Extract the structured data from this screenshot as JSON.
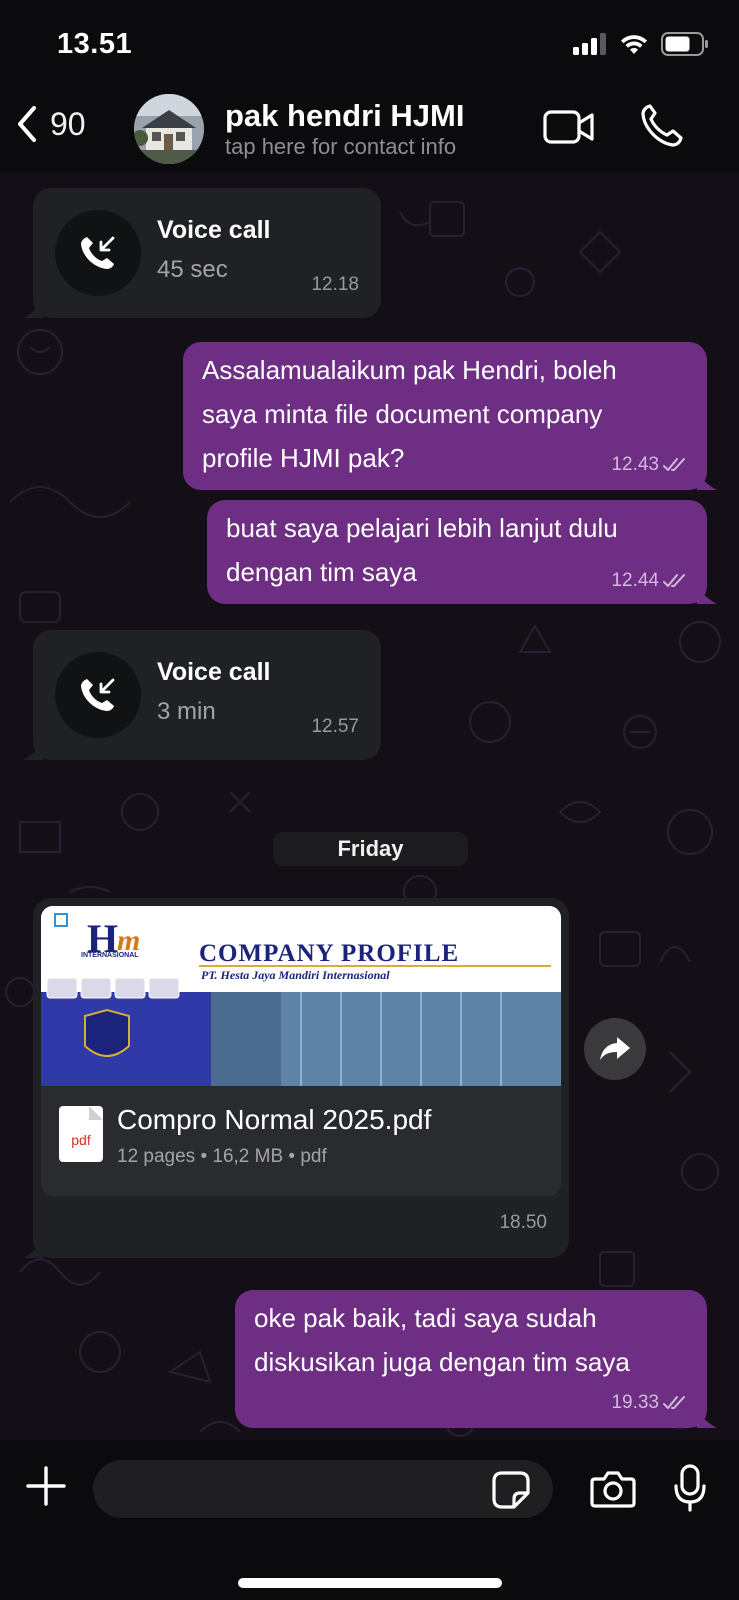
{
  "status": {
    "time": "13.51"
  },
  "header": {
    "back_count": "90",
    "contact_name": "pak hendri HJMI",
    "subtitle": "tap here for contact info"
  },
  "messages": {
    "call1": {
      "title": "Voice call",
      "duration": "45 sec",
      "time": "12.18"
    },
    "out1": {
      "lines": [
        "Assalamualaikum pak Hendri, boleh",
        "saya minta file document company",
        "profile HJMI pak?"
      ],
      "time": "12.43"
    },
    "out2": {
      "lines": [
        "buat saya pelajari lebih lanjut dulu",
        "dengan tim saya"
      ],
      "time": "12.44"
    },
    "call2": {
      "title": "Voice call",
      "duration": "3 min",
      "time": "12.57"
    },
    "day_separator": "Friday",
    "document": {
      "preview_title": "COMPANY PROFILE",
      "preview_subtitle": "PT. Hesta Jaya Mandiri Internasional",
      "preview_logo_text": "INTERNASIONAL",
      "file_name": "Compro  Normal 2025.pdf",
      "meta": "12 pages • 16,2 MB • pdf",
      "icon_label": "pdf",
      "time": "18.50"
    },
    "out3": {
      "lines": [
        "oke pak baik, tadi saya sudah",
        "diskusikan juga dengan tim saya"
      ],
      "time": "19.33"
    }
  },
  "input": {
    "placeholder": ""
  },
  "colors": {
    "outgoing_bubble": "#6d2e83",
    "incoming_bubble": "#202124",
    "chat_background": "#140f16"
  }
}
